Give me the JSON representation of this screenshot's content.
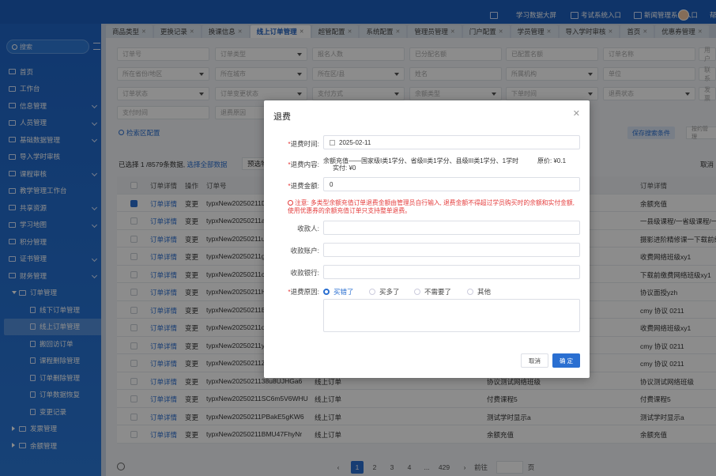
{
  "topbar": {
    "items": [
      "学习数据大屏",
      "考试系统入口",
      "新闻管理系统入口"
    ],
    "more": "帮"
  },
  "sidebar": {
    "search_placeholder": "搜索",
    "menu": [
      {
        "label": "首页",
        "level": 1
      },
      {
        "label": "工作台",
        "level": 1
      },
      {
        "label": "信息管理",
        "level": 1,
        "chevron": true
      },
      {
        "label": "人员管理",
        "level": 1,
        "chevron": true
      },
      {
        "label": "基础数据管理",
        "level": 1,
        "chevron": true
      },
      {
        "label": "导入学时审核",
        "level": 1
      },
      {
        "label": "课程审核",
        "level": 1,
        "chevron": true
      },
      {
        "label": "教学管理工作台",
        "level": 1
      },
      {
        "label": "共享资源",
        "level": 1,
        "chevron": true
      },
      {
        "label": "学习地图",
        "level": 1,
        "chevron": true
      },
      {
        "label": "积分管理",
        "level": 1
      },
      {
        "label": "证书管理",
        "level": 1,
        "chevron": true
      },
      {
        "label": "财务管理",
        "level": 1,
        "chevron": true
      },
      {
        "label": "订单管理",
        "level": 2
      },
      {
        "label": "线下订单管理",
        "level": 3
      },
      {
        "label": "线上订单管理",
        "level": 3,
        "active": true
      },
      {
        "label": "搬回访订单",
        "level": 3
      },
      {
        "label": "课程删除管理",
        "level": 3
      },
      {
        "label": "订单删除管理",
        "level": 3
      },
      {
        "label": "订单数据恢复",
        "level": 3
      },
      {
        "label": "变更记录",
        "level": 3
      },
      {
        "label": "发票管理",
        "level": 2,
        "collapsed": true
      },
      {
        "label": "余额管理",
        "level": 2,
        "collapsed": true
      }
    ]
  },
  "tabs": [
    {
      "label": "商品类型"
    },
    {
      "label": "更换记录"
    },
    {
      "label": "换课信息"
    },
    {
      "label": "线上订单管理",
      "active": true
    },
    {
      "label": "超管配置"
    },
    {
      "label": "系统配置"
    },
    {
      "label": "管理员管理"
    },
    {
      "label": "门户配置"
    },
    {
      "label": "学员管理"
    },
    {
      "label": "导入学时审核"
    },
    {
      "label": "首页"
    },
    {
      "label": "优惠券管理"
    }
  ],
  "filters": {
    "row1": [
      "订单号",
      "订单类型",
      "报名人数",
      "已分配名额",
      "已配置名额",
      "订单名称",
      "用户"
    ],
    "row2": [
      "所在省份/地区",
      "所在城市",
      "所在区/县",
      "姓名",
      "所属机构",
      "单位",
      "联系"
    ],
    "row3": [
      "订单状态",
      "订单变更状态",
      "支付方式",
      "余额类型",
      "下单时间",
      "退费状态",
      "发票"
    ],
    "row4": [
      "支付时间",
      "退费原因"
    ],
    "config_label": "检索区配置",
    "save_label": "保存搜索条件",
    "refresh_label": "按约管理"
  },
  "selection": {
    "text": "已选择 1 /8579条数据, ",
    "select_all": "选择全部数据",
    "preset": "预选物",
    "cancel": "取消"
  },
  "table": {
    "headers": [
      "订单详情",
      "操作",
      "订单号",
      "订单详情"
    ],
    "rows": [
      {
        "detail": "订单详情",
        "op": "变更",
        "no": "typxNew20250211D",
        "type": "",
        "name": "",
        "desc": "余额充值",
        "checked": true
      },
      {
        "detail": "订单详情",
        "op": "变更",
        "no": "typxNew20250211a",
        "type": "",
        "name": "",
        "desc": "一县级课程/一省级课程/一",
        "checked": false
      },
      {
        "detail": "订单详情",
        "op": "变更",
        "no": "typxNew20250211u",
        "type": "",
        "name": "",
        "desc": "摄影进阶精修课一下载前缴",
        "checked": false
      },
      {
        "detail": "订单详情",
        "op": "变更",
        "no": "typxNew20250211g",
        "type": "",
        "name": "",
        "desc": "收费网络班级xy1",
        "checked": false
      },
      {
        "detail": "订单详情",
        "op": "变更",
        "no": "typxNew20250211c",
        "type": "",
        "name": "",
        "desc": "下载前缴费网络班级xy1",
        "checked": false
      },
      {
        "detail": "订单详情",
        "op": "变更",
        "no": "typxNew20250211H",
        "type": "",
        "name": "",
        "desc": "协议面授yzh",
        "checked": false
      },
      {
        "detail": "订单详情",
        "op": "变更",
        "no": "typxNew20250211B",
        "type": "",
        "name": "",
        "desc": "cmy 协议 0211",
        "checked": false
      },
      {
        "detail": "订单详情",
        "op": "变更",
        "no": "typxNew20250211d",
        "type": "",
        "name": "",
        "desc": "收费网络班级xy1",
        "checked": false
      },
      {
        "detail": "订单详情",
        "op": "变更",
        "no": "typxNew20250211y",
        "type": "",
        "name": "",
        "desc": "cmy 协议 0211",
        "checked": false
      },
      {
        "detail": "订单详情",
        "op": "变更",
        "no": "typxNew20250211Z",
        "type": "",
        "name": "",
        "desc": "cmy 协议 0211",
        "checked": false
      },
      {
        "detail": "订单详情",
        "op": "变更",
        "no": "typxNew2025021138u8UJHGa6",
        "type": "线上订单",
        "name": "协议测试网络班级",
        "desc": "协议测试网络班级",
        "checked": false
      },
      {
        "detail": "订单详情",
        "op": "变更",
        "no": "typxNew20250211SC6m5V6WHU",
        "type": "线上订单",
        "name": "付费课程5",
        "desc": "付费课程5",
        "checked": false
      },
      {
        "detail": "订单详情",
        "op": "变更",
        "no": "typxNew20250211PBakE5gKW6",
        "type": "线上订单",
        "name": "测试学时显示a",
        "desc": "测试学时显示a",
        "checked": false
      },
      {
        "detail": "订单详情",
        "op": "变更",
        "no": "typxNew20250211BMU47FhyNr",
        "type": "线上订单",
        "name": "余额充值",
        "desc": "余额充值",
        "checked": false
      }
    ]
  },
  "pager": {
    "pages": [
      "1",
      "2",
      "3",
      "4",
      "...",
      "429"
    ],
    "current": "1",
    "goto_label": "前往",
    "page_unit": "页"
  },
  "modal": {
    "title": "退费",
    "refund_time_label": "退费时间:",
    "refund_time_value": "2025-02-11",
    "refund_content_label": "退费内容:",
    "refund_content_value": "余额充值——国家级I类1学分、省级II类1学分、县级III类1学分、1学时",
    "original_price": "原价: ¥0.1",
    "actual_paid": "实付: ¥0",
    "refund_amount_label": "退费金额:",
    "refund_amount_value": "0",
    "notice": "注意: 多类型余额充值订单退费金额由管理员自行输入, 退费金额不得超过学员购买时的余额和实付金额, 使用优惠券的余额充值订单只支持整单退费。",
    "payee_label": "收款人:",
    "account_label": "收款账户:",
    "bank_label": "收款银行:",
    "reason_label": "退费原因:",
    "reasons": [
      "买错了",
      "买多了",
      "不需要了",
      "其他"
    ],
    "selected_reason": "买错了",
    "cancel_label": "取消",
    "ok_label": "确 定"
  },
  "colors": {
    "primary": "#2a6fd1",
    "sidebar": "#1f66c9",
    "danger": "#e43b3b"
  }
}
